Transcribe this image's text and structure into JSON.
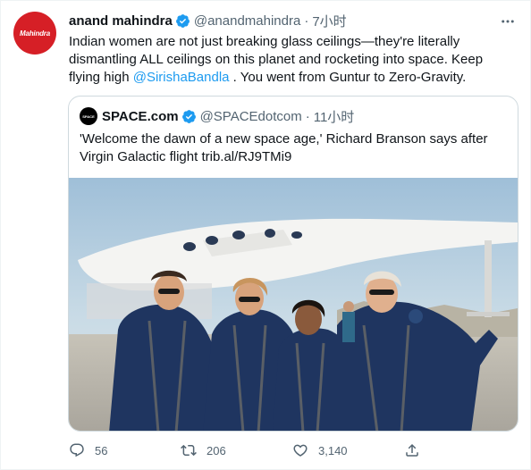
{
  "tweet": {
    "author_name": "anand mahindra",
    "author_handle": "@anandmahindra",
    "separator": "·",
    "time": "7小时",
    "avatar_logo_text": "Mahindra",
    "text_before_mention": "Indian women are not just breaking glass ceilings—they're literally dismantling ALL ceilings on this planet and rocketing into space. Keep flying high ",
    "mention": "@SirishaBandla",
    "text_after_mention": " . You went from Guntur to Zero-Gravity."
  },
  "quote": {
    "author_name": "SPACE.com",
    "author_handle": "@SPACEdotcom",
    "separator": "·",
    "time": "11小时",
    "avatar_text": "SPACE",
    "text": "'Welcome the dawn of a new space age,' Richard Branson says after Virgin Galactic flight trib.al/RJ9TMi9"
  },
  "actions": {
    "reply_count": "56",
    "retweet_count": "206",
    "like_count": "3,140"
  },
  "colors": {
    "link": "#1d9bf0",
    "verified": "#1d9bf0",
    "secondary_text": "#536471",
    "avatar_brand": "#d61f26",
    "border": "#cfd9de"
  }
}
